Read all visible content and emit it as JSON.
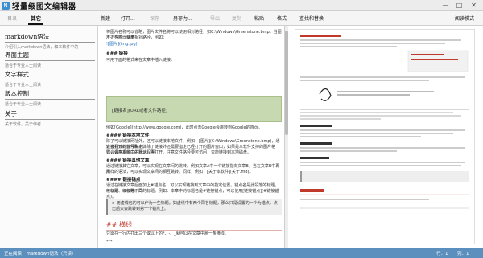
{
  "app": {
    "icon_glyph": "N",
    "title": "轻量级图文编辑器"
  },
  "window": {
    "minimize": "—",
    "maximize": "□",
    "close": "✕"
  },
  "left_tabs": [
    {
      "label": "目录"
    },
    {
      "label": "其它",
      "active": true
    }
  ],
  "toolbar": {
    "new": "新建",
    "open": "打开...",
    "save": "保存",
    "save_as": "另存为...",
    "export": "导出",
    "copy": "复制",
    "paste": "粘贴",
    "format": "格式",
    "find_replace": "查找和替换",
    "read_mode": "阅读模式"
  },
  "sidebar": {
    "items": [
      {
        "title": "markdown语法",
        "desc": "介绍引入markdown语法，和本软件中的"
      },
      {
        "title": "界面主题",
        "desc": "适合于专业人士阅读"
      },
      {
        "title": "文字样式",
        "desc": "适合于专业人士阅读"
      },
      {
        "title": "版本控制",
        "desc": "适合于专业人士阅读"
      },
      {
        "title": "关于",
        "desc": "关于软件，关于作者"
      }
    ]
  },
  "editor": {
    "line1": "将图片名称可以省略，图片文件名将可以使用相对路径，如C:\\Windows\\Greenstone.bmp。当图片不在同一目录",
    "line2": "下，也可以使用相对路径，例如：",
    "line3": "![图片](img.jpg)",
    "h_link": "### 链接",
    "link_intro": "可用下面的格式来在文章中插入链接：",
    "link_syntax": "[链接名](URL或者文件路径)",
    "link_example": "例如[Google](http://www.google.com)，此时点击Google会跳转到Google的首页。",
    "h_file": "#### 链接本地文件",
    "file_desc1": "除了可以链接网址外，还可以链接本地文件，例如：[图片](C:\\Windows\\Greenstone.bmp)，通过查看该标签号和字体",
    "file_desc2": "会被打开的软件确定。除了链接外还需要指定已经打开的图片窗口，如果是本软件支持的图片格式，会在本窗口中显示；否",
    "file_desc3": "则会调用系统中的默认程序打开。注意文件路径要可访问，只能链接到本地磁盘。",
    "h_article": "#### 链接其他文章",
    "article_desc1": "通过链接其它文章，可以实现在文章间的跳转。例如文章A中一个链接指向文章B，当在文章B中再用",
    "article_desc2": "同样的语法，可以实现文章间的相互跳转。同样，例如：[关于本软件](关于.md)。",
    "h_anchor": "#### 链接锚点",
    "anchor_desc1": "通过在链接文章后面加上#锚点名，可以实现链接到文章中的指定位置。锚点名是此段落的标题，可以是一级标题、二",
    "anchor_desc2": "级标题、三级等不同的标题。例如：本章中的标题名是#链接锚点，可以使用[链接锚点](#链接锚点)。",
    "h2": "## 横线",
    "hr_desc": "只需在一行内打出三个或以上的*、-、_就可以在文章中画一条横线。",
    "hr_example": "***",
    "quote": "> 用虚线包的可以作为一些标题。如虚线中有两个同名标题，那么只是设置的一个为锚点，点击后只会跳转到第一个锚点上。"
  },
  "preview": {
    "sections": [
      "markdown语法",
      "其它",
      "保存文件时需要注意：",
      "链接本地文件",
      "链接其他文章",
      "链接锚点",
      "横线"
    ]
  },
  "status": {
    "left": "正在阅读：markdown语法（只读）",
    "line": "行：1",
    "col": "列：1"
  },
  "colors": {
    "statusbar": "#5b8fbe",
    "heading_red": "#c0392b",
    "quote_green": "#c7d9b0",
    "link_blue": "#1a6bb8"
  }
}
